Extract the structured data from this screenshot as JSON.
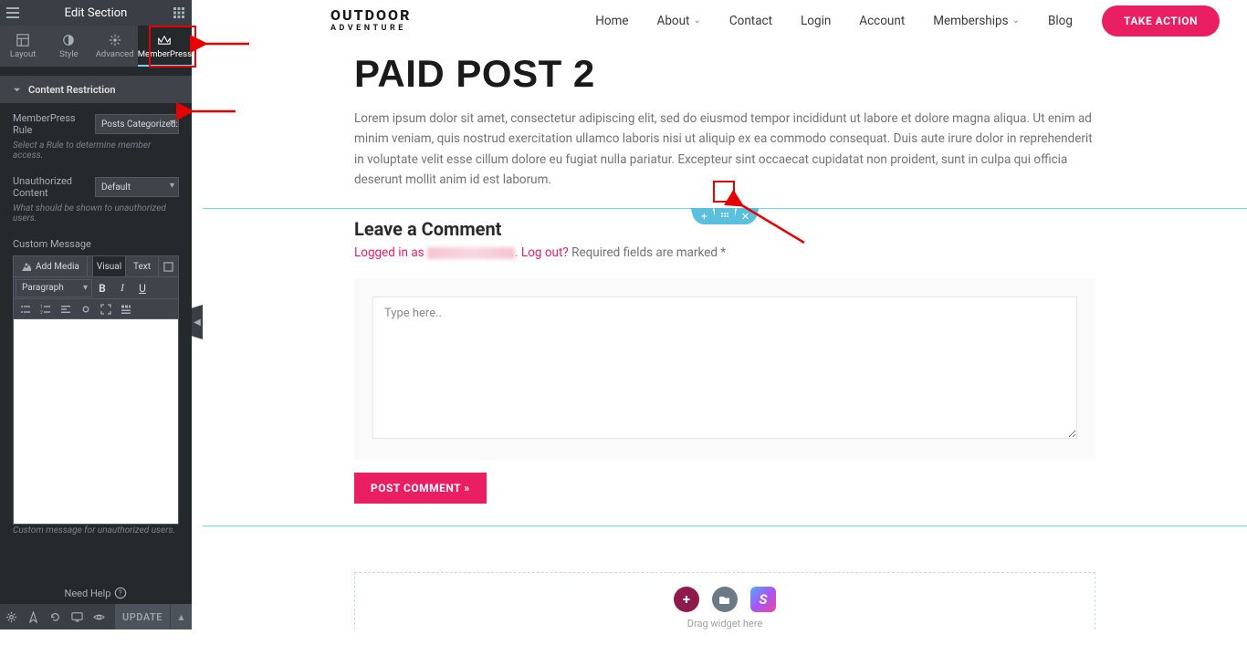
{
  "sidebar": {
    "title": "Edit Section",
    "tabs": [
      {
        "label": "Layout"
      },
      {
        "label": "Style"
      },
      {
        "label": "Advanced"
      },
      {
        "label": "MemberPress"
      }
    ],
    "accordion": "Content Restriction",
    "rule_label": "MemberPress Rule",
    "rule_value": "Posts Categorized: P",
    "rule_hint": "Select a Rule to determine member access.",
    "unauth_label": "Unauthorized Content",
    "unauth_value": "Default",
    "unauth_hint": "What should be shown to unauthorized users.",
    "custom_msg_label": "Custom Message",
    "add_media": "Add Media",
    "tab_visual": "Visual",
    "tab_text": "Text",
    "paragraph": "Paragraph",
    "custom_hint": "Custom message for unauthorized users.",
    "need_help": "Need Help",
    "update": "UPDATE"
  },
  "site": {
    "brand_top": "OUTDOOR",
    "brand_sub": "ADVENTURE",
    "nav": [
      {
        "label": "Home"
      },
      {
        "label": "About",
        "chev": true
      },
      {
        "label": "Contact"
      },
      {
        "label": "Login"
      },
      {
        "label": "Account"
      },
      {
        "label": "Memberships",
        "chev": true
      },
      {
        "label": "Blog"
      }
    ],
    "cta": "TAKE ACTION"
  },
  "post": {
    "title": "PAID POST 2",
    "body": "Lorem ipsum dolor sit amet, consectetur adipiscing elit, sed do eiusmod tempor incididunt ut labore et dolore magna aliqua. Ut enim ad minim veniam, quis nostrud exercitation ullamco laboris nisi ut aliquip ex ea commodo consequat. Duis aute irure dolor in reprehenderit in voluptate velit esse cillum dolore eu fugiat nulla pariatur. Excepteur sint occaecat cupidatat non proident, sunt in culpa qui officia deserunt mollit anim id est laborum."
  },
  "comment": {
    "heading": "Leave a Comment",
    "logged_in": "Logged in as ",
    "logout": "Log out?",
    "required": "Required fields are marked *",
    "placeholder": "Type here..",
    "button": "POST COMMENT »",
    "drag_widget": "Drag widget here"
  }
}
